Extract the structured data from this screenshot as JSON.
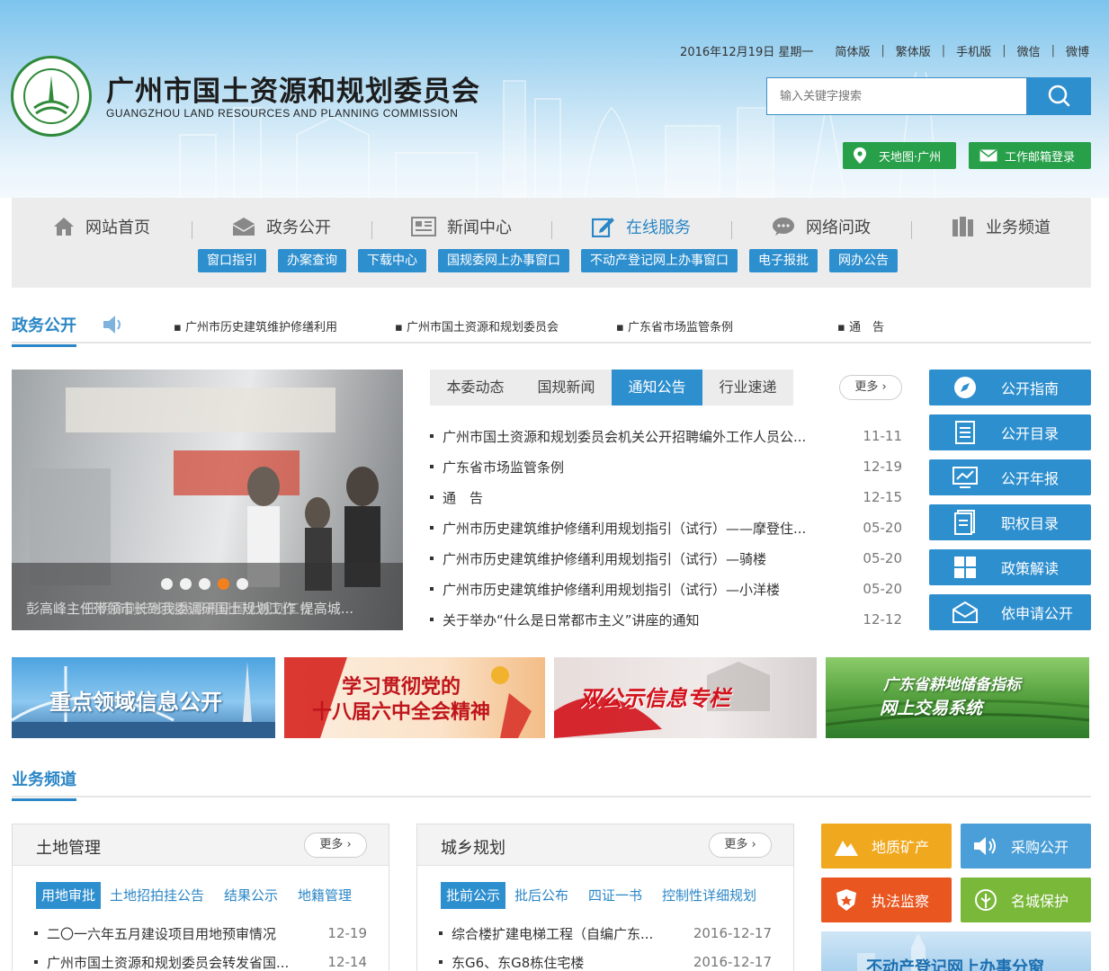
{
  "header": {
    "org_cn": "广州市国土资源和规划委员会",
    "org_en": "GUANGZHOU LAND RESOURCES AND PLANNING COMMISSION",
    "date": "2016年12月19日 星期一",
    "links": [
      "简体版",
      "繁体版",
      "手机版",
      "微信",
      "微博"
    ],
    "search_placeholder": "输入关键字搜索",
    "map_button": "天地图·广州",
    "mail_button": "工作邮箱登录"
  },
  "nav": {
    "items": [
      {
        "label": "网站首页",
        "icon": "home-icon"
      },
      {
        "label": "政务公开",
        "icon": "envelope-icon"
      },
      {
        "label": "新闻中心",
        "icon": "newspaper-icon"
      },
      {
        "label": "在线服务",
        "icon": "edit-icon"
      },
      {
        "label": "网络问政",
        "icon": "chat-icon"
      },
      {
        "label": "业务频道",
        "icon": "books-icon"
      }
    ],
    "active": "在线服务",
    "sub_tags": [
      "窗口指引",
      "办案查询",
      "下载中心",
      "国规委网上办事窗口",
      "不动产登记网上办事窗口",
      "电子报批",
      "网办公告"
    ]
  },
  "ticker": {
    "title": "政务公开",
    "items": [
      "广州市历史建筑维护修缮利用",
      "广州市国土资源和规划委员会",
      "广东省市场监管条例",
      "通　告"
    ]
  },
  "slider": {
    "caption": "彭高峰主任带领市长到我委调研国土规划工作 提高城...",
    "caption_overlay": "任朝锋副市长到我委调研国土规划工作",
    "dots": 5,
    "active_dot": 4
  },
  "news": {
    "tabs": [
      "本委动态",
      "国规新闻",
      "通知公告",
      "行业速递"
    ],
    "active_tab": "通知公告",
    "more": "更多",
    "items": [
      {
        "title": "广州市国土资源和规划委员会机关公开招聘编外工作人员公...",
        "date": "11-11"
      },
      {
        "title": "广东省市场监管条例",
        "date": "12-19"
      },
      {
        "title": "通　告",
        "date": "12-15"
      },
      {
        "title": "广州市历史建筑维护修缮利用规划指引（试行）——摩登住...",
        "date": "05-20"
      },
      {
        "title": "广州市历史建筑维护修缮利用规划指引（试行）—骑楼",
        "date": "05-20"
      },
      {
        "title": "广州市历史建筑维护修缮利用规划指引（试行）—小洋楼",
        "date": "05-20"
      },
      {
        "title": "关于举办“什么是日常都市主义”讲座的通知",
        "date": "12-12"
      }
    ]
  },
  "side_buttons": [
    {
      "label": "公开指南",
      "icon": "compass-icon"
    },
    {
      "label": "公开目录",
      "icon": "list-icon"
    },
    {
      "label": "公开年报",
      "icon": "chart-icon"
    },
    {
      "label": "职权目录",
      "icon": "document-icon"
    },
    {
      "label": "政策解读",
      "icon": "grid-icon"
    },
    {
      "label": "依申请公开",
      "icon": "mail-icon"
    }
  ],
  "banners": [
    {
      "text": "重点领域信息公开"
    },
    {
      "text_line1": "学习贯彻党的",
      "text_line2": "十八届六中全会精神"
    },
    {
      "text": "双公示信息专栏"
    },
    {
      "text_line1": "广东省耕地储备指标",
      "text_line2": "网上交易系统"
    }
  ],
  "channel": {
    "title": "业务频道",
    "land": {
      "title": "土地管理",
      "more": "更多",
      "tabs": [
        "用地审批",
        "土地招拍挂公告",
        "结果公示",
        "地籍管理"
      ],
      "active_tab": "用地审批",
      "items": [
        {
          "title": "二〇一六年五月建设项目用地预审情况",
          "date": "12-19"
        },
        {
          "title": "广州市国土资源和规划委员会转发省国...",
          "date": "12-14"
        }
      ]
    },
    "planning": {
      "title": "城乡规划",
      "more": "更多",
      "tabs": [
        "批前公示",
        "批后公布",
        "四证一书",
        "控制性详细规划"
      ],
      "active_tab": "批前公示",
      "items": [
        {
          "title": "综合楼扩建电梯工程（自编广东...",
          "date": "2016-12-17"
        },
        {
          "title": "东G6、东G8栋住宅楼",
          "date": "2016-12-17"
        }
      ]
    },
    "buttons": [
      {
        "label": "地质矿产",
        "icon": "mountain-icon",
        "color": "#f0a81e"
      },
      {
        "label": "采购公开",
        "icon": "speaker-icon",
        "color": "#4a9fd8"
      },
      {
        "label": "执法监察",
        "icon": "badge-icon",
        "color": "#e9561f"
      },
      {
        "label": "名城保护",
        "icon": "tree-icon",
        "color": "#7ab83a"
      }
    ],
    "bottom_banner": "不动产登记网上办事分窗"
  },
  "colors": {
    "primary": "#2e8fcf",
    "green": "#28a04a"
  }
}
